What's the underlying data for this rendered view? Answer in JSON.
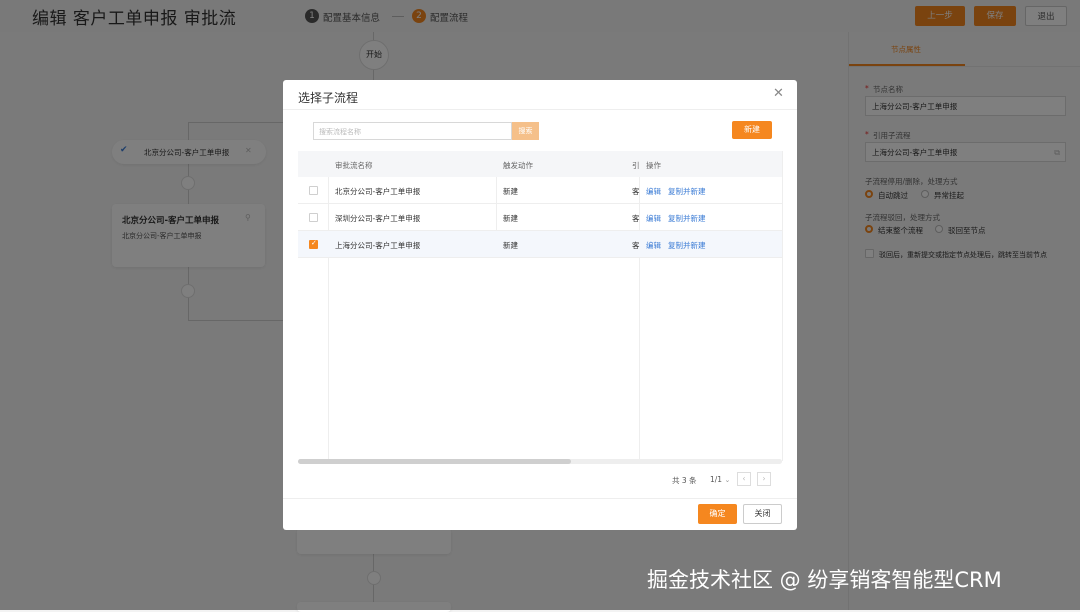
{
  "header": {
    "title": "编辑 客户工单申报 审批流",
    "steps": [
      {
        "num": "1",
        "label": "配置基本信息"
      },
      {
        "num": "2",
        "label": "配置流程"
      }
    ],
    "buttons": {
      "prev": "上一步",
      "save": "保存",
      "exit": "退出"
    }
  },
  "canvas": {
    "start_label": "开始",
    "branch_node_label": "北京分公司-客户工单申报",
    "card": {
      "title": "北京分公司-客户工单申报",
      "subtitle": "北京分公司-客户工单申报"
    }
  },
  "right_panel": {
    "tab": "节点属性",
    "node_name_label": "节点名称",
    "node_name_value": "上海分公司-客户工单申报",
    "sub_flow_label": "引用子流程",
    "sub_flow_value": "上海分公司-客户工单申报",
    "disable_label": "子流程停用/删除，处理方式",
    "disable_options": [
      "自动跳过",
      "异常挂起"
    ],
    "reject_label": "子流程驳回，处理方式",
    "reject_options": [
      "结束整个流程",
      "驳回至节点"
    ],
    "resubmit_label": "驳回后，重新提交或指定节点处理后，跳转至当前节点"
  },
  "dialog": {
    "title": "选择子流程",
    "search_placeholder": "搜索流程名称",
    "search_button": "搜索",
    "new_button": "新建",
    "columns": [
      "审批流名称",
      "触发动作",
      "引",
      "操作"
    ],
    "rows": [
      {
        "name": "北京分公司-客户工单申报",
        "action": "新建",
        "ref": "客",
        "checked": false
      },
      {
        "name": "深圳分公司-客户工单申报",
        "action": "新建",
        "ref": "客",
        "checked": false
      },
      {
        "name": "上海分公司-客户工单申报",
        "action": "新建",
        "ref": "客",
        "checked": true
      }
    ],
    "op_edit": "编辑",
    "op_copy": "复制并新建",
    "total": "共 3 条",
    "page": "1/1",
    "confirm_button": "确定",
    "close_button": "关闭"
  },
  "watermark": "掘金技术社区 @ 纷享销客智能型CRM",
  "colors": {
    "accent": "#f5871f",
    "link": "#3a7bd5"
  }
}
